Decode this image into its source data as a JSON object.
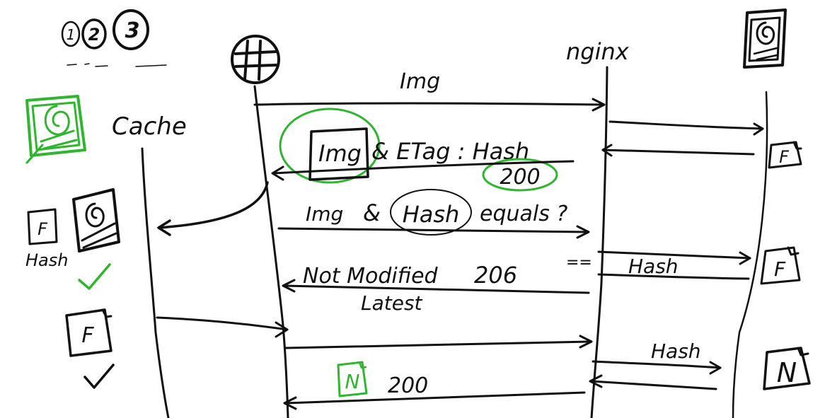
{
  "numbers": [
    "1",
    "2",
    "3"
  ],
  "actors": {
    "cache": "Cache",
    "server": "nginx"
  },
  "messages": {
    "request_img": "Img",
    "response_img": "Img",
    "response_etag": "& ETag : Hash",
    "response_status": "200",
    "compare_img": "Img",
    "compare_amp": "&",
    "compare_hash": "Hash",
    "compare_equals": "equals ?",
    "equals_mark": "==",
    "server_hash_1": "Hash",
    "not_modified": "Not Modified",
    "not_modified_code": "206",
    "latest": "Latest",
    "server_hash_2": "Hash",
    "final_status": "200"
  },
  "file_labels": {
    "f": "F",
    "n": "N",
    "hash_under_file": "Hash"
  },
  "ticks": [
    "✓",
    "✓"
  ],
  "colors": {
    "ink": "#111111",
    "highlight": "#2fb52f",
    "background": "#ffffff"
  }
}
